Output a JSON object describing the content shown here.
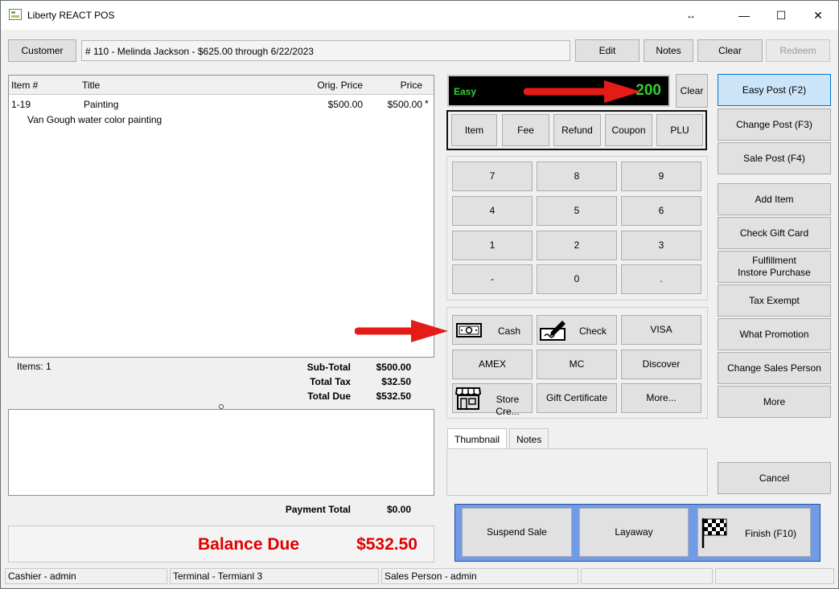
{
  "window": {
    "title": "Liberty REACT POS",
    "restore_glyph": "↔",
    "minimize_glyph": "—",
    "maximize_glyph": "☐",
    "close_glyph": "✕"
  },
  "customer": {
    "button_label": "Customer",
    "info": "# 110 - Melinda Jackson -  $625.00 through 6/22/2023",
    "edit_label": "Edit",
    "notes_label": "Notes",
    "clear_label": "Clear",
    "redeem_label": "Redeem"
  },
  "items_table": {
    "headers": {
      "item": "Item #",
      "title": "Title",
      "orig_price": "Orig. Price",
      "price": "Price"
    },
    "rows": [
      {
        "item": "1-19",
        "title": "Painting",
        "orig_price": "$500.00",
        "price": "$500.00",
        "flag": "*",
        "description": "Van Gough water color painting"
      }
    ]
  },
  "totals": {
    "items_count": "Items: 1",
    "subtotal_label": "Sub-Total",
    "subtotal_value": "$500.00",
    "tax_label": "Total Tax",
    "tax_value": "$32.50",
    "due_label": "Total Due",
    "due_value": "$532.50",
    "payment_label": "Payment Total",
    "payment_value": "$0.00",
    "balance_label": "Balance Due",
    "balance_value": "$532.50"
  },
  "entry": {
    "mode": "Easy",
    "value": "200",
    "clear_label": "Clear"
  },
  "entry_types": [
    "Item",
    "Fee",
    "Refund",
    "Coupon",
    "PLU"
  ],
  "keypad": [
    "7",
    "8",
    "9",
    "4",
    "5",
    "6",
    "1",
    "2",
    "3",
    "-",
    "0",
    "."
  ],
  "tenders": {
    "cash": "Cash",
    "check": "Check",
    "visa": "VISA",
    "amex": "AMEX",
    "mc": "MC",
    "discover": "Discover",
    "store_credit": "Store Cre...",
    "gift_certificate": "Gift Certificate",
    "more": "More..."
  },
  "tabs": {
    "thumbnail": "Thumbnail",
    "notes": "Notes"
  },
  "side_actions": {
    "easy_post": "Easy Post (F2)",
    "change_post": "Change Post (F3)",
    "sale_post": "Sale Post (F4)",
    "add_item": "Add Item",
    "check_gift_card": "Check Gift Card",
    "fulfillment_line1": "Fulfillment",
    "fulfillment_line2": "Instore Purchase",
    "tax_exempt": "Tax Exempt",
    "what_promotion": "What Promotion",
    "change_sales_person": "Change Sales Person",
    "more": "More",
    "cancel": "Cancel"
  },
  "bottom_actions": {
    "suspend": "Suspend Sale",
    "layaway": "Layaway",
    "finish": "Finish (F10)"
  },
  "status": {
    "cashier": "Cashier - admin",
    "terminal": "Terminal - Termianl 3",
    "sales_person": "Sales Person - admin"
  },
  "colors": {
    "display_bg": "#000000",
    "display_text": "#2fd12f",
    "balance_red": "#e00000",
    "highlight_blue": "#cce4f7",
    "bottom_panel_blue": "#6f9be8",
    "arrow_red": "#e41b17"
  }
}
